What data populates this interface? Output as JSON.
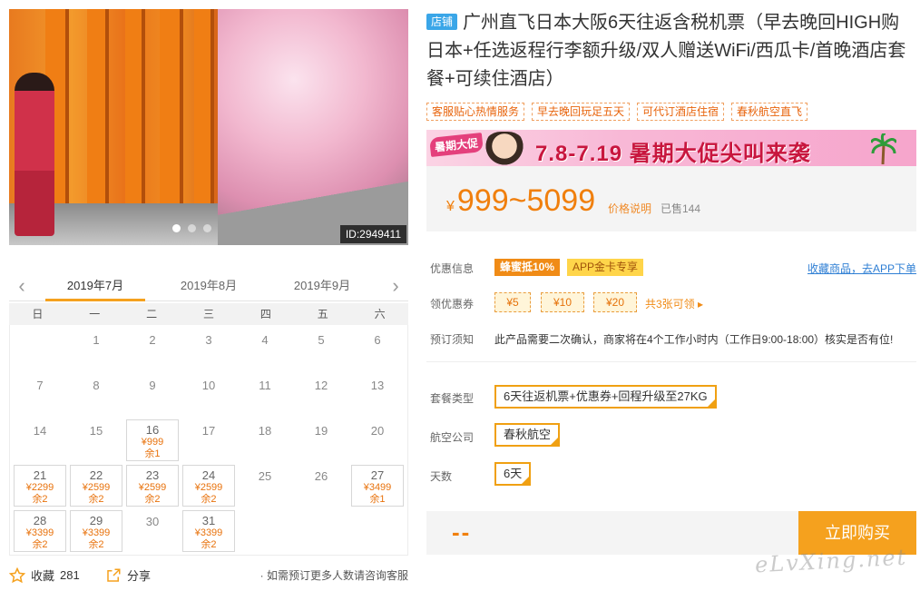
{
  "gallery": {
    "image_id": "ID:2949411",
    "dots": 3,
    "active_dot": 0
  },
  "calendar": {
    "months": [
      "2019年7月",
      "2019年8月",
      "2019年9月"
    ],
    "active_month": 0,
    "weekdays": [
      "日",
      "一",
      "二",
      "三",
      "四",
      "五",
      "六"
    ],
    "cells": [
      {
        "day": ""
      },
      {
        "day": "1"
      },
      {
        "day": "2"
      },
      {
        "day": "3"
      },
      {
        "day": "4"
      },
      {
        "day": "5"
      },
      {
        "day": "6"
      },
      {
        "day": "7"
      },
      {
        "day": "8"
      },
      {
        "day": "9"
      },
      {
        "day": "10"
      },
      {
        "day": "11"
      },
      {
        "day": "12"
      },
      {
        "day": "13"
      },
      {
        "day": "14"
      },
      {
        "day": "15"
      },
      {
        "day": "16",
        "price": "¥999",
        "stock": "余1"
      },
      {
        "day": "17"
      },
      {
        "day": "18"
      },
      {
        "day": "19"
      },
      {
        "day": "20"
      },
      {
        "day": "21",
        "price": "¥2299",
        "stock": "余2"
      },
      {
        "day": "22",
        "price": "¥2599",
        "stock": "余2"
      },
      {
        "day": "23",
        "price": "¥2599",
        "stock": "余2"
      },
      {
        "day": "24",
        "price": "¥2599",
        "stock": "余2"
      },
      {
        "day": "25"
      },
      {
        "day": "26"
      },
      {
        "day": "27",
        "price": "¥3499",
        "stock": "余1"
      },
      {
        "day": "28",
        "price": "¥3399",
        "stock": "余2"
      },
      {
        "day": "29",
        "price": "¥3399",
        "stock": "余2"
      },
      {
        "day": "30"
      },
      {
        "day": "31",
        "price": "¥3399",
        "stock": "余2"
      },
      {
        "day": ""
      },
      {
        "day": ""
      },
      {
        "day": ""
      }
    ]
  },
  "actions": {
    "favorite_label": "收藏",
    "favorite_count": "281",
    "share_label": "分享",
    "notice": "· 如需预订更多人数请咨询客服"
  },
  "product": {
    "shop_badge": "店铺",
    "title": "广州直飞日本大阪6天往返含税机票（早去晚回HIGH购日本+任选返程行李额升级/双人赠送WiFi/西瓜卡/首晚酒店套餐+可续住酒店）",
    "tags": [
      "客服贴心热情服务",
      "早去晚回玩足五天",
      "可代订酒店住宿",
      "春秋航空直飞"
    ]
  },
  "banner": {
    "label": "暑期大促",
    "text": "7.8-7.19 暑期大促尖叫来袭"
  },
  "price": {
    "currency": "¥",
    "range": "999~5099",
    "note": "价格说明",
    "sold": "已售144"
  },
  "promo": {
    "label": "优惠信息",
    "tag_a": "蜂蜜抵10%",
    "tag_b": "APP金卡专享",
    "fav_link": "收藏商品，去APP下单"
  },
  "coupons": {
    "label": "领优惠券",
    "items": [
      "¥5",
      "¥10",
      "¥20"
    ],
    "more": "共3张可领 ▸"
  },
  "booking": {
    "label": "预订须知",
    "note": "此产品需要二次确认，商家将在4个工作小时内（工作日9:00-18:00）核实是否有位!"
  },
  "options": {
    "package_label": "套餐类型",
    "package_value": "6天往返机票+优惠券+回程升级至27KG",
    "airline_label": "航空公司",
    "airline_value": "春秋航空",
    "days_label": "天数",
    "days_value": "6天"
  },
  "buy": {
    "price_placeholder": "--",
    "button": "立即购买"
  },
  "watermark": "eLvXing.net",
  "colors": {
    "accent": "#f5a11e",
    "price": "#f07f0d",
    "link": "#2f7fd4",
    "badge": "#3aa6e8"
  }
}
